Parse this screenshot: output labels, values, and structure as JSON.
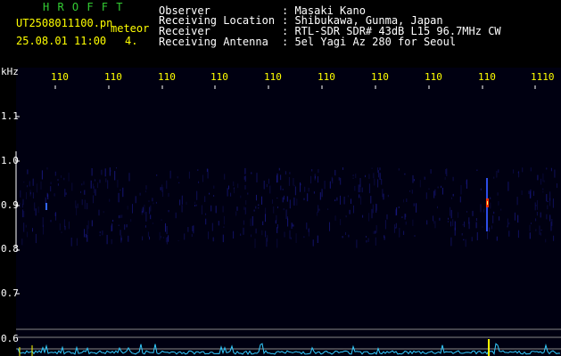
{
  "header": {
    "app_name": "H R O F F T",
    "filename": "UT2508011100.pn",
    "mode": "meteor",
    "datetime": "25.08.01 11:00",
    "count": "4.",
    "info_labels": [
      "Observer",
      "Receiving Location",
      "Receiver",
      "Receiving Antenna"
    ],
    "info_values": [
      ": Masaki Kano",
      ": Shibukawa, Gunma, Japan",
      ": RTL-SDR SDR# 43dB L15 96.7MHz CW",
      ": 5el Yagi Az 280 for Seoul"
    ]
  },
  "plot": {
    "unit_label": "kHz",
    "x_tick_labels": [
      "110",
      "110",
      "110",
      "110",
      "110",
      "110",
      "110",
      "110",
      "110",
      "1110"
    ],
    "y_tick_labels": [
      "1.1",
      "1.0",
      "0.9",
      "0.8",
      "0.7",
      "0.6"
    ],
    "colors": {
      "background": "#000011",
      "grid": "#ffffff",
      "noise": "#1a1a8c",
      "hot": "#ff3300",
      "profile": "#33ccff",
      "profile_peak": "#ffff00"
    }
  }
}
